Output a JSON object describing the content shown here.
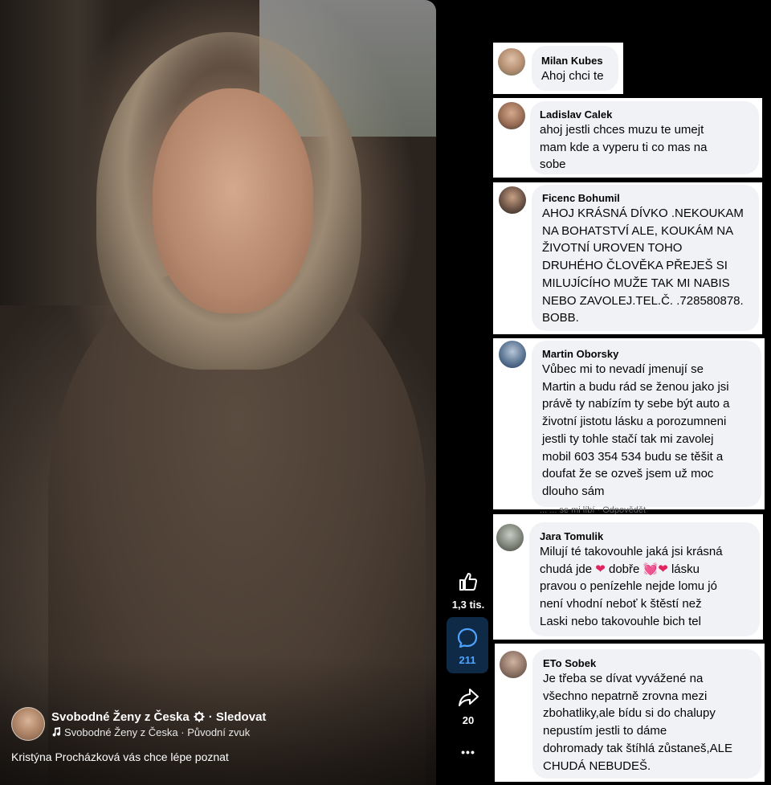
{
  "video": {
    "page_name": "Svobodné Ženy z Česka",
    "page_badge_icon": "gear-badge-icon",
    "follow_label": "· Sledovat",
    "audio_line": "Svobodné Ženy z Česka · Původní zvuk",
    "caption": "Kristýna Procházková vás chce lépe poznat"
  },
  "actions": {
    "like_count": "1,3 tis.",
    "comment_count": "211",
    "share_count": "20",
    "more_label": "•••"
  },
  "comments": [
    {
      "name": "Milan Kubes",
      "text": "Ahoj chci te"
    },
    {
      "name": "Ladislav Calek",
      "text": "ahoj jestli chces muzu te umejt\nmam kde a vyperu ti co mas na\nsobe"
    },
    {
      "name": "Ficenc Bohumil",
      "text": "AHOJ KRÁSNÁ DÍVKO .NEKOUKAM\nNA BOHATSTVÍ ALE, KOUKÁM NA\nŽIVOTNÍ UROVEN TOHO\nDRUHÉHO ČLOVĚKA PŘEJEŠ SI\nMILUJÍCÍHO MUŽE TAK MI NABIS\nNEBO ZAVOLEJ.TEL.Č. .728580878.\nBOBB."
    },
    {
      "name": "Martin Oborsky",
      "text": "Vůbec mi to nevadí jmenují se\nMartin a budu rád se ženou jako jsi\nprávě ty nabízím ty sebe být auto a\nživotní jistotu lásku a porozumneni\njestli ty tohle stačí tak mi zavolej\nmobil 603 354 534 budu se těšit a\ndoufat že se ozveš jsem už moc\ndlouho sám"
    },
    {
      "name": "Jara Tomulik",
      "text_before": "Milují té takovouhle jaká jsi krásná\nchudá jde ",
      "text_mid1": " dobře ",
      "text_mid2": " lásku\npravou o penízehle nejde lomu jó\nnení vhodní neboť k štěstí než\nLaski nebo takovouhle bich tel"
    },
    {
      "name": "ETo Sobek",
      "text": "Je třeba se dívat vyvážené na\nvšechno nepatrně zrovna mezi\nzbohatliky,ale bídu si do chalupy\nnepustím jestli to dáme\ndohromady tak štíhlá zůstaneš,ALE\nCHUDÁ NEBUDEŠ."
    }
  ],
  "partial_text": "...  ...  se mi líbí  ·  Odpovědět"
}
